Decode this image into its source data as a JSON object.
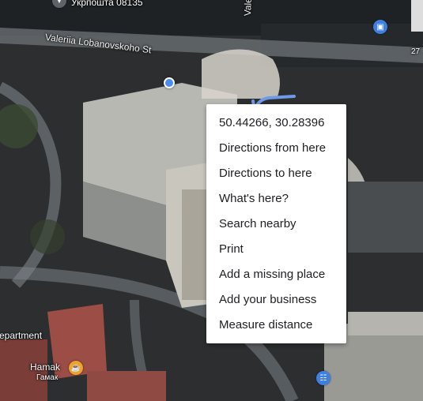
{
  "map": {
    "street_name": "Valeriia Lobanovskoho St",
    "street_vertical": "Valeriia",
    "poi_top_sub": "Укрпошта 08135",
    "poi_department": "epartment",
    "poi_hamak": "Hamak",
    "poi_hamak_sub": "Гамак",
    "edge_number": "27",
    "icons": [
      "map-pin-icon",
      "shopping-bag-icon",
      "cafe-trophy-icon",
      "shopping-cart-icon",
      "blue-location-dot-icon",
      "cursor-arrow-icon"
    ],
    "colors": {
      "pin_blue": "#3f7fe0",
      "pin_orange": "#f0a22a",
      "location_dot": "#4a8df0"
    }
  },
  "context_menu": {
    "items": [
      "50.44266, 30.28396",
      "Directions from here",
      "Directions to here",
      "What's here?",
      "Search nearby",
      "Print",
      "Add a missing place",
      "Add your business",
      "Measure distance"
    ]
  }
}
